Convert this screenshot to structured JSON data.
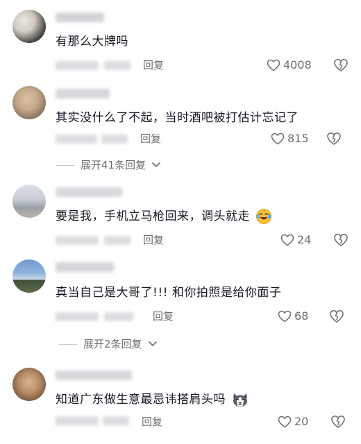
{
  "reply_label": "回复",
  "comments": [
    {
      "text": "有那么大牌吗",
      "likes": "4008",
      "avatar_icon": "avatar-photo"
    },
    {
      "text": "其实没什么了不起，当时酒吧被打估计忘记了",
      "likes": "815",
      "expand_label": "展开41条回复",
      "avatar_icon": "avatar-photo"
    },
    {
      "text": "要是我，手机立马枪回来，调头就走",
      "emoji": "laughing-crying-emoji",
      "likes": "24",
      "avatar_icon": "avatar-photo"
    },
    {
      "text": "真当自己是大哥了!!! 和你拍照是给你面子",
      "likes": "68",
      "expand_label": "展开2条回复",
      "avatar_icon": "avatar-photo"
    },
    {
      "text": "知道广东做生意最忌讳搭肩头吗",
      "emoji": "husky-dog-emoji",
      "likes": "20",
      "avatar_icon": "avatar-photo"
    }
  ],
  "colors": {
    "text": "#161823",
    "secondary": "#6d6e73",
    "blurred": "#dcdde0"
  }
}
